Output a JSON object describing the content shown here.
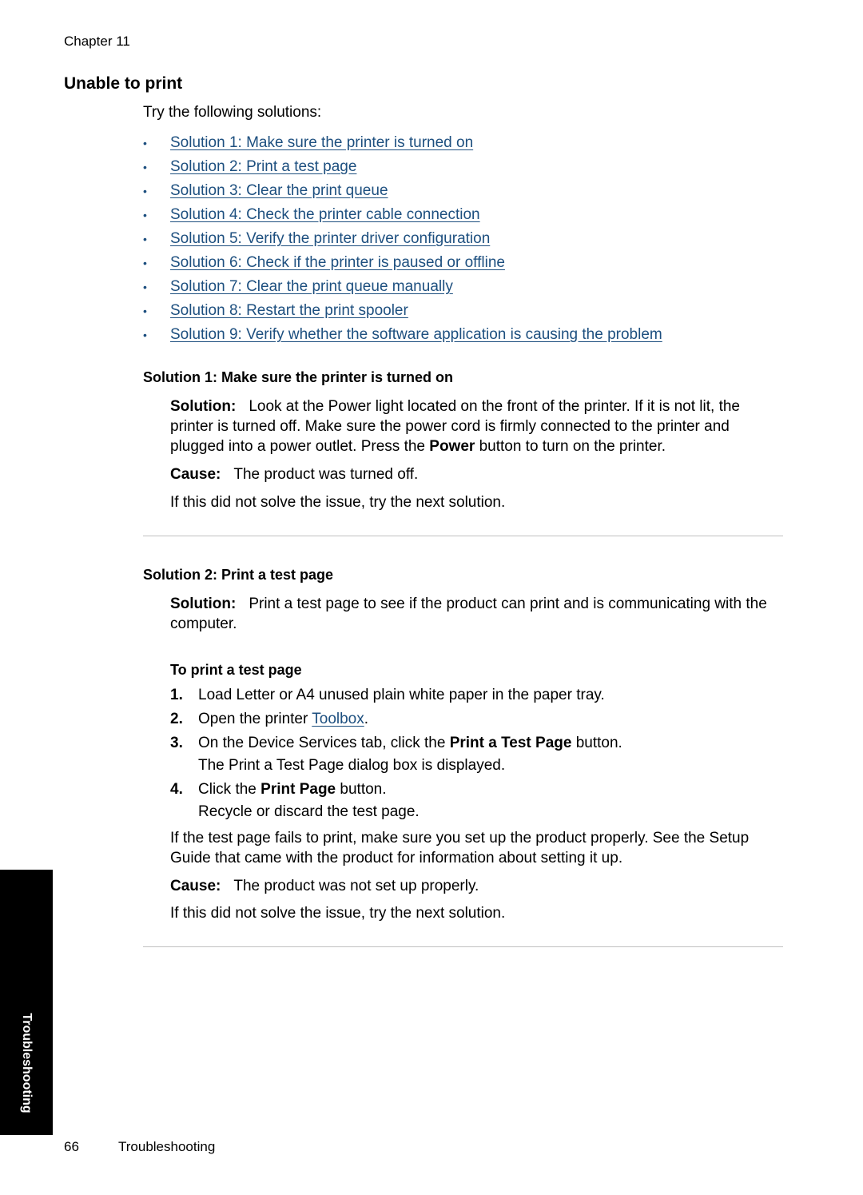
{
  "header": {
    "chapter": "Chapter 11"
  },
  "title": "Unable to print",
  "intro": "Try the following solutions:",
  "toc": [
    "Solution 1: Make sure the printer is turned on",
    "Solution 2: Print a test page",
    "Solution 3: Clear the print queue",
    "Solution 4: Check the printer cable connection",
    "Solution 5: Verify the printer driver configuration",
    "Solution 6: Check if the printer is paused or offline",
    "Solution 7: Clear the print queue manually",
    "Solution 8: Restart the print spooler",
    "Solution 9: Verify whether the software application is causing the problem"
  ],
  "solution1": {
    "heading": "Solution 1: Make sure the printer is turned on",
    "solution_label": "Solution:",
    "solution_text_1": "Look at the Power light located on the front of the printer. If it is not lit, the printer is turned off. Make sure the power cord is firmly connected to the printer and plugged into a power outlet. Press the ",
    "solution_bold": "Power",
    "solution_text_2": " button to turn on the printer.",
    "cause_label": "Cause:",
    "cause_text": "The product was turned off.",
    "next": "If this did not solve the issue, try the next solution."
  },
  "solution2": {
    "heading": "Solution 2: Print a test page",
    "solution_label": "Solution:",
    "solution_text": "Print a test page to see if the product can print and is communicating with the computer.",
    "procedure_heading": "To print a test page",
    "steps": [
      {
        "num": "1.",
        "text": "Load Letter or A4 unused plain white paper in the paper tray."
      },
      {
        "num": "2.",
        "pre": "Open the printer ",
        "link": "Toolbox",
        "post": "."
      },
      {
        "num": "3.",
        "pre": "On the Device Services tab, click the ",
        "bold": "Print a Test Page",
        "post": " button.",
        "sub": "The Print a Test Page dialog box is displayed."
      },
      {
        "num": "4.",
        "pre": "Click the ",
        "bold": "Print Page",
        "post": " button.",
        "sub": "Recycle or discard the test page."
      }
    ],
    "followup": "If the test page fails to print, make sure you set up the product properly. See the Setup Guide that came with the product for information about setting it up.",
    "cause_label": "Cause:",
    "cause_text": "The product was not set up properly.",
    "next": "If this did not solve the issue, try the next solution."
  },
  "side_tab": "Troubleshooting",
  "footer": {
    "page_number": "66",
    "section": "Troubleshooting"
  },
  "colors": {
    "link": "#1d4f7f",
    "rule": "#c0c0c0",
    "tab": "#000000"
  }
}
